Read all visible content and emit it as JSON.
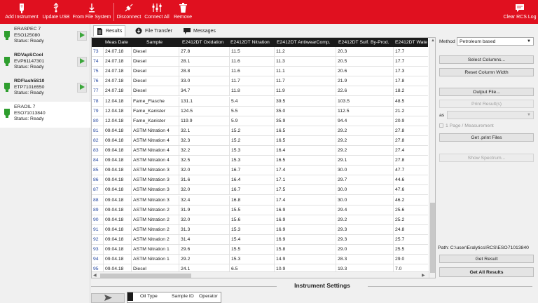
{
  "toolbar": {
    "add_instrument": "Add Instrument",
    "update_usb": "Update USB",
    "from_file_system": "From File System",
    "disconnect": "Disconnect",
    "connect_all": "Connect All",
    "remove": "Remove",
    "clear_rcs_log": "Clear RCS Log"
  },
  "instruments": [
    {
      "name": "ERASPEC 7",
      "serial": "ESO125080",
      "status": "Status:  Ready",
      "bulb_color": "#2e9e2e"
    },
    {
      "name": "RDVapSCool",
      "serial": "EVP61147301",
      "status": "Status:  Ready",
      "bulb_color": "#2e9e2e"
    },
    {
      "name": "RDFlash5S10",
      "serial": "ETP71016550",
      "status": "Status:  Ready",
      "bulb_color": "#2e9e2e"
    },
    {
      "name": "ERAOIL 7",
      "serial": "ESO71013840",
      "status": "Status:  Ready",
      "bulb_color": "#2e9e2e"
    }
  ],
  "tabs": {
    "results": "Results",
    "file_transfer": "File Transfer",
    "messages": "Messages"
  },
  "table": {
    "headers": [
      "Meas Date",
      "Sample",
      "E2412DT Oxidation",
      "E2412DT Nitration",
      "E2412DT AntiwearComp.",
      "E2412DT Sulf. By-Prod.",
      "E2412DT Wate"
    ],
    "rows": [
      {
        "n": "73",
        "cells": [
          "24.07.18",
          "Diesel",
          "27.8",
          "11.5",
          "11.2",
          "20.3",
          "17.7"
        ]
      },
      {
        "n": "74",
        "cells": [
          "24.07.18",
          "Diesel",
          "28.1",
          "11.6",
          "11.3",
          "20.5",
          "17.7"
        ]
      },
      {
        "n": "75",
        "cells": [
          "24.07.18",
          "Diesel",
          "28.8",
          "11.6",
          "11.1",
          "20.6",
          "17.3"
        ]
      },
      {
        "n": "76",
        "cells": [
          "24.07.18",
          "Diesel",
          "33.0",
          "11.7",
          "11.7",
          "21.9",
          "17.8"
        ]
      },
      {
        "n": "77",
        "cells": [
          "24.07.18",
          "Diesel",
          "34.7",
          "11.8",
          "11.9",
          "22.6",
          "18.2"
        ]
      },
      {
        "n": "78",
        "cells": [
          "12.04.18",
          "Fame_Flasche",
          "131.1",
          "5.4",
          "39.5",
          "103.5",
          "48.5"
        ]
      },
      {
        "n": "79",
        "cells": [
          "12.04.18",
          "Fame_Kanister",
          "124.5",
          "5.5",
          "35.0",
          "112.5",
          "21.2"
        ]
      },
      {
        "n": "80",
        "cells": [
          "12.04.18",
          "Fame_Kanister",
          "119.9",
          "5.9",
          "35.9",
          "94.4",
          "20.9"
        ]
      },
      {
        "n": "81",
        "cells": [
          "09.04.18",
          "ASTM Nitration 4",
          "32.1",
          "15.2",
          "16.5",
          "29.2",
          "27.8"
        ]
      },
      {
        "n": "82",
        "cells": [
          "09.04.18",
          "ASTM Nitration 4",
          "32.3",
          "15.2",
          "16.5",
          "29.2",
          "27.8"
        ]
      },
      {
        "n": "83",
        "cells": [
          "09.04.18",
          "ASTM Nitration 4",
          "32.2",
          "15.3",
          "16.4",
          "29.2",
          "27.4"
        ]
      },
      {
        "n": "84",
        "cells": [
          "09.04.18",
          "ASTM Nitration 4",
          "32.5",
          "15.3",
          "16.5",
          "29.1",
          "27.8"
        ]
      },
      {
        "n": "85",
        "cells": [
          "09.04.18",
          "ASTM Nitration 3",
          "32.0",
          "16.7",
          "17.4",
          "30.0",
          "47.7"
        ]
      },
      {
        "n": "86",
        "cells": [
          "09.04.18",
          "ASTM Nitration 3",
          "31.6",
          "16.4",
          "17.1",
          "29.7",
          "44.6"
        ]
      },
      {
        "n": "87",
        "cells": [
          "09.04.18",
          "ASTM Nitration 3",
          "32.0",
          "16.7",
          "17.5",
          "30.0",
          "47.6"
        ]
      },
      {
        "n": "88",
        "cells": [
          "09.04.18",
          "ASTM Nitration 3",
          "32.4",
          "16.8",
          "17.4",
          "30.0",
          "46.2"
        ]
      },
      {
        "n": "89",
        "cells": [
          "09.04.18",
          "ASTM Nitration 2",
          "31.9",
          "15.5",
          "16.9",
          "29.4",
          "25.6"
        ]
      },
      {
        "n": "90",
        "cells": [
          "09.04.18",
          "ASTM Nitration 2",
          "32.0",
          "15.6",
          "16.9",
          "29.2",
          "25.2"
        ]
      },
      {
        "n": "91",
        "cells": [
          "09.04.18",
          "ASTM Nitration 2",
          "31.3",
          "15.3",
          "16.9",
          "29.3",
          "24.8"
        ]
      },
      {
        "n": "92",
        "cells": [
          "09.04.18",
          "ASTM Nitration 2",
          "31.4",
          "15.4",
          "16.9",
          "29.3",
          "25.7"
        ]
      },
      {
        "n": "93",
        "cells": [
          "09.04.18",
          "ASTM Nitration 1",
          "29.6",
          "15.5",
          "15.8",
          "29.0",
          "25.5"
        ]
      },
      {
        "n": "94",
        "cells": [
          "09.04.18",
          "ASTM Nitration 1",
          "29.2",
          "15.3",
          "14.9",
          "28.3",
          "29.0"
        ]
      },
      {
        "n": "95",
        "cells": [
          "09.04.18",
          "Diesel",
          "24.1",
          "6.5",
          "10.9",
          "19.3",
          "7.0"
        ]
      }
    ]
  },
  "right_panel": {
    "method_label": "Method",
    "method_value": "Petroleum based",
    "select_columns": "Select Columns...",
    "reset_column_width": "Reset Column Width",
    "output_file": "Output File...",
    "print_results": "Print Result(s)",
    "as_label": "as",
    "one_page": "1 Page / Measurement",
    "get_print_files": "Get .print Files",
    "show_spectrum": "Show Spectrum...",
    "path": "Path: C:\\user\\Eralytics\\RCS\\ESO71013840",
    "get_result": "Get Result",
    "get_all_results": "Get All Results"
  },
  "bottom": {
    "instrument_settings": "Instrument Settings",
    "headers": [
      "Oil Type",
      "Sample ID",
      "Operator"
    ]
  },
  "colors": {
    "accent": "#e0101f",
    "header_bg": "#1a1a1a",
    "row_number": "#2346a0",
    "play": "#3aa63a"
  }
}
